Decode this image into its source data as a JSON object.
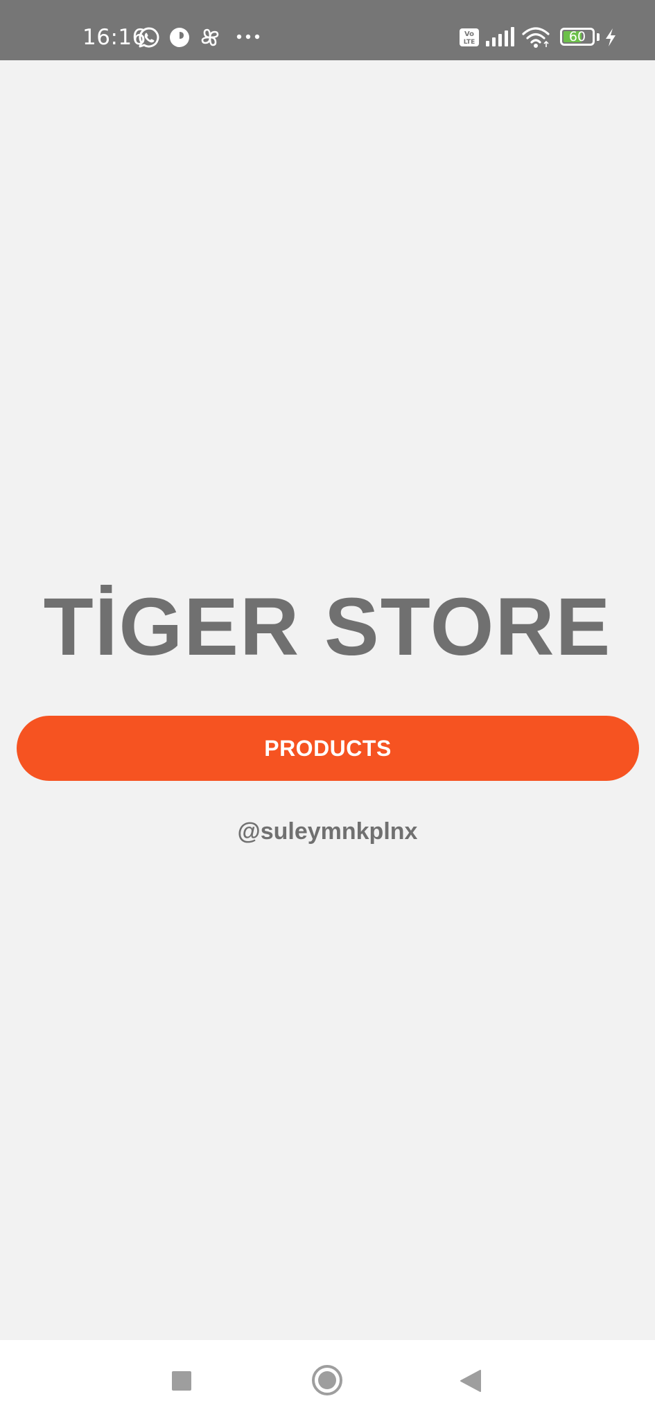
{
  "status_bar": {
    "time": "16:16",
    "battery_level": "60",
    "notification_icons": [
      "whatsapp-icon",
      "app-icon",
      "pinwheel-icon",
      "more-dots-icon"
    ],
    "system_icons": [
      "volte-icon",
      "signal-icon",
      "wifi-icon",
      "battery-icon",
      "charging-icon"
    ]
  },
  "main": {
    "title": "TİGER STORE",
    "products_button_label": "PRODUCTS",
    "handle": "@suleymnkplnx"
  },
  "nav_bar": {
    "buttons": [
      "recents-square-icon",
      "home-circle-icon",
      "back-triangle-icon"
    ]
  },
  "colors": {
    "status_bar": "#767676",
    "background": "#f2f2f2",
    "accent": "#f65321",
    "text_gray": "#707070",
    "battery_fill": "#6cc04a",
    "nav_icon": "#9e9e9e"
  }
}
